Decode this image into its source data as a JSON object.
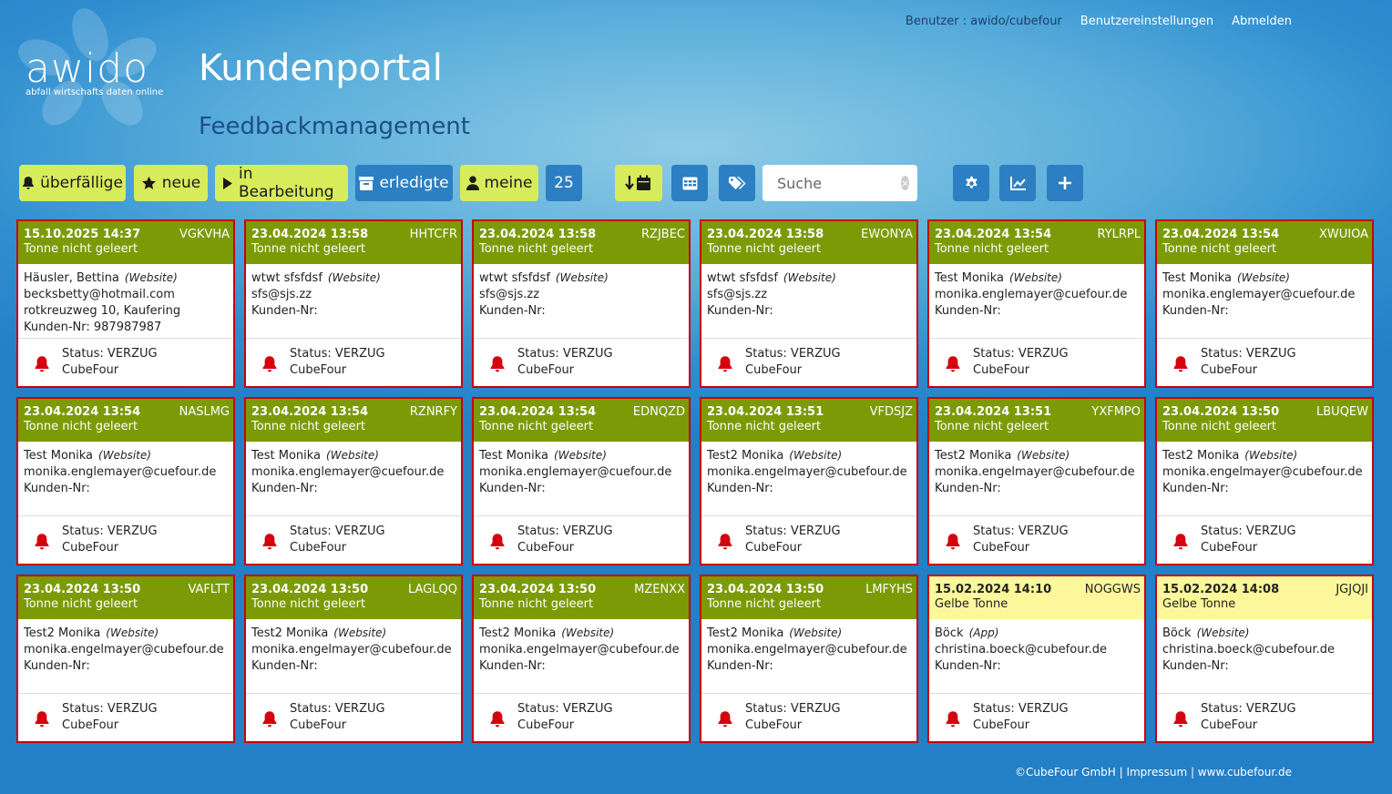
{
  "logo": {
    "name": "awido",
    "tagline": "abfall wirtschafts daten online"
  },
  "header": {
    "title": "Kundenportal",
    "subtitle": "Feedbackmanagement"
  },
  "topnav": {
    "user": "Benutzer : awido/cubefour",
    "settings": "Benutzereinstellungen",
    "logout": "Abmelden"
  },
  "toolbar": {
    "overdue": "überfällige",
    "new": "neue",
    "in_progress": "in Bearbeitung",
    "done": "erledigte",
    "mine": "meine",
    "count": "25",
    "search_placeholder": "Suche"
  },
  "cards": [
    {
      "date": "15.10.2025 14:37",
      "code": "VGKVHA",
      "category": "Tonne nicht geleert",
      "color": "olive",
      "name": "Häusler, Bettina",
      "source": "(Website)",
      "email": "becksbetty@hotmail.com",
      "address": "rotkreuzweg 10, Kaufering",
      "customer": "Kunden-Nr: 987987987",
      "status": "Status: VERZUG",
      "company": "CubeFour"
    },
    {
      "date": "23.04.2024 13:58",
      "code": "HHTCFR",
      "category": "Tonne nicht geleert",
      "color": "olive",
      "name": "wtwt sfsfdsf",
      "source": "(Website)",
      "email": "sfs@sjs.zz",
      "address": "Kunden-Nr:",
      "customer": "",
      "status": "Status: VERZUG",
      "company": "CubeFour"
    },
    {
      "date": "23.04.2024 13:58",
      "code": "RZJBEC",
      "category": "Tonne nicht geleert",
      "color": "olive",
      "name": "wtwt sfsfdsf",
      "source": "(Website)",
      "email": "sfs@sjs.zz",
      "address": "Kunden-Nr:",
      "customer": "",
      "status": "Status: VERZUG",
      "company": "CubeFour"
    },
    {
      "date": "23.04.2024 13:58",
      "code": "EWONYA",
      "category": "Tonne nicht geleert",
      "color": "olive",
      "name": "wtwt sfsfdsf",
      "source": "(Website)",
      "email": "sfs@sjs.zz",
      "address": "Kunden-Nr:",
      "customer": "",
      "status": "Status: VERZUG",
      "company": "CubeFour"
    },
    {
      "date": "23.04.2024 13:54",
      "code": "RYLRPL",
      "category": "Tonne nicht geleert",
      "color": "olive",
      "name": "Test Monika",
      "source": "(Website)",
      "email": "monika.englemayer@cuefour.de",
      "address": "Kunden-Nr:",
      "customer": "",
      "status": "Status: VERZUG",
      "company": "CubeFour"
    },
    {
      "date": "23.04.2024 13:54",
      "code": "XWUIOA",
      "category": "Tonne nicht geleert",
      "color": "olive",
      "name": "Test Monika",
      "source": "(Website)",
      "email": "monika.englemayer@cuefour.de",
      "address": "Kunden-Nr:",
      "customer": "",
      "status": "Status: VERZUG",
      "company": "CubeFour"
    },
    {
      "date": "23.04.2024 13:54",
      "code": "NASLMG",
      "category": "Tonne nicht geleert",
      "color": "olive",
      "name": "Test Monika",
      "source": "(Website)",
      "email": "monika.englemayer@cuefour.de",
      "address": "Kunden-Nr:",
      "customer": "",
      "status": "Status: VERZUG",
      "company": "CubeFour"
    },
    {
      "date": "23.04.2024 13:54",
      "code": "RZNRFY",
      "category": "Tonne nicht geleert",
      "color": "olive",
      "name": "Test Monika",
      "source": "(Website)",
      "email": "monika.englemayer@cuefour.de",
      "address": "Kunden-Nr:",
      "customer": "",
      "status": "Status: VERZUG",
      "company": "CubeFour"
    },
    {
      "date": "23.04.2024 13:54",
      "code": "EDNQZD",
      "category": "Tonne nicht geleert",
      "color": "olive",
      "name": "Test Monika",
      "source": "(Website)",
      "email": "monika.englemayer@cuefour.de",
      "address": "Kunden-Nr:",
      "customer": "",
      "status": "Status: VERZUG",
      "company": "CubeFour"
    },
    {
      "date": "23.04.2024 13:51",
      "code": "VFDSJZ",
      "category": "Tonne nicht geleert",
      "color": "olive",
      "name": "Test2 Monika",
      "source": "(Website)",
      "email": "monika.engelmayer@cubefour.de",
      "address": "Kunden-Nr:",
      "customer": "",
      "status": "Status: VERZUG",
      "company": "CubeFour"
    },
    {
      "date": "23.04.2024 13:51",
      "code": "YXFMPO",
      "category": "Tonne nicht geleert",
      "color": "olive",
      "name": "Test2 Monika",
      "source": "(Website)",
      "email": "monika.engelmayer@cubefour.de",
      "address": "Kunden-Nr:",
      "customer": "",
      "status": "Status: VERZUG",
      "company": "CubeFour"
    },
    {
      "date": "23.04.2024 13:50",
      "code": "LBUQEW",
      "category": "Tonne nicht geleert",
      "color": "olive",
      "name": "Test2 Monika",
      "source": "(Website)",
      "email": "monika.engelmayer@cubefour.de",
      "address": "Kunden-Nr:",
      "customer": "",
      "status": "Status: VERZUG",
      "company": "CubeFour"
    },
    {
      "date": "23.04.2024 13:50",
      "code": "VAFLTT",
      "category": "Tonne nicht geleert",
      "color": "olive",
      "name": "Test2 Monika",
      "source": "(Website)",
      "email": "monika.engelmayer@cubefour.de",
      "address": "Kunden-Nr:",
      "customer": "",
      "status": "Status: VERZUG",
      "company": "CubeFour"
    },
    {
      "date": "23.04.2024 13:50",
      "code": "LAGLQQ",
      "category": "Tonne nicht geleert",
      "color": "olive",
      "name": "Test2 Monika",
      "source": "(Website)",
      "email": "monika.engelmayer@cubefour.de",
      "address": "Kunden-Nr:",
      "customer": "",
      "status": "Status: VERZUG",
      "company": "CubeFour"
    },
    {
      "date": "23.04.2024 13:50",
      "code": "MZENXX",
      "category": "Tonne nicht geleert",
      "color": "olive",
      "name": "Test2 Monika",
      "source": "(Website)",
      "email": "monika.engelmayer@cubefour.de",
      "address": "Kunden-Nr:",
      "customer": "",
      "status": "Status: VERZUG",
      "company": "CubeFour"
    },
    {
      "date": "23.04.2024 13:50",
      "code": "LMFYHS",
      "category": "Tonne nicht geleert",
      "color": "olive",
      "name": "Test2 Monika",
      "source": "(Website)",
      "email": "monika.engelmayer@cubefour.de",
      "address": "Kunden-Nr:",
      "customer": "",
      "status": "Status: VERZUG",
      "company": "CubeFour"
    },
    {
      "date": "15.02.2024 14:10",
      "code": "NOGGWS",
      "category": "Gelbe Tonne",
      "color": "yellow",
      "name": "Böck",
      "source": "(App)",
      "email": "christina.boeck@cubefour.de",
      "address": "Kunden-Nr:",
      "customer": "",
      "status": "Status: VERZUG",
      "company": "CubeFour"
    },
    {
      "date": "15.02.2024 14:08",
      "code": "JGJQJI",
      "category": "Gelbe Tonne",
      "color": "yellow",
      "name": "Böck",
      "source": "(Website)",
      "email": "christina.boeck@cubefour.de",
      "address": "Kunden-Nr:",
      "customer": "",
      "status": "Status: VERZUG",
      "company": "CubeFour"
    }
  ],
  "footer": {
    "text": "©CubeFour GmbH | Impressum | www.cubefour.de"
  },
  "colors": {
    "olive": "#7c9a06",
    "yellow": "#fbf79a",
    "lime": "#d6ec5a",
    "blue": "#2c7fc2",
    "alert": "#c7000f"
  }
}
